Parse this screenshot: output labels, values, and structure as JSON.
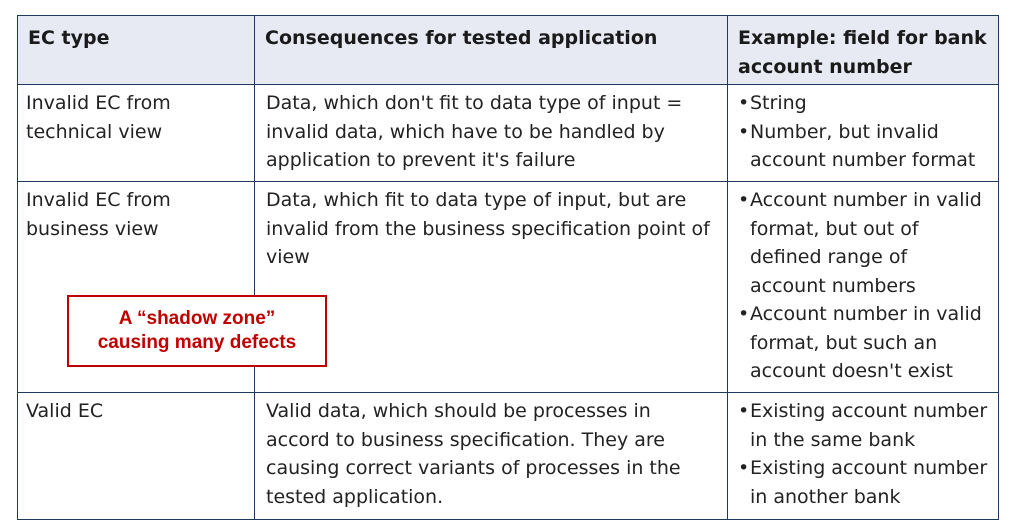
{
  "table": {
    "headers": [
      "EC type",
      "Consequences for tested application",
      "Example: field for bank account number"
    ],
    "rows": [
      {
        "type": "Invalid EC from technical view",
        "consequence": "Data, which don't fit to data type of input = invalid data, which have to be handled by application to prevent it's failure",
        "examples": [
          "String",
          "Number, but invalid account number format"
        ]
      },
      {
        "type": "Invalid EC from business view",
        "consequence": "Data, which fit to data type of input, but are invalid from the business specification point of view",
        "examples": [
          "Account number in valid format, but out of defined range of account numbers",
          "Account number in valid format, but such an account doesn't exist"
        ]
      },
      {
        "type": "Valid EC",
        "consequence": "Valid data, which should be processes in accord to business specification. They are causing correct variants of processes in the tested application.",
        "examples": [
          "Existing account number in the same bank",
          "Existing account number in another bank"
        ]
      }
    ]
  },
  "callout": {
    "line1": "A “shadow zone”",
    "line2": "causing many defects"
  },
  "colors": {
    "border": "#1f3a5f",
    "header_bg": "#e7eaf3",
    "callout": "#c00000"
  }
}
